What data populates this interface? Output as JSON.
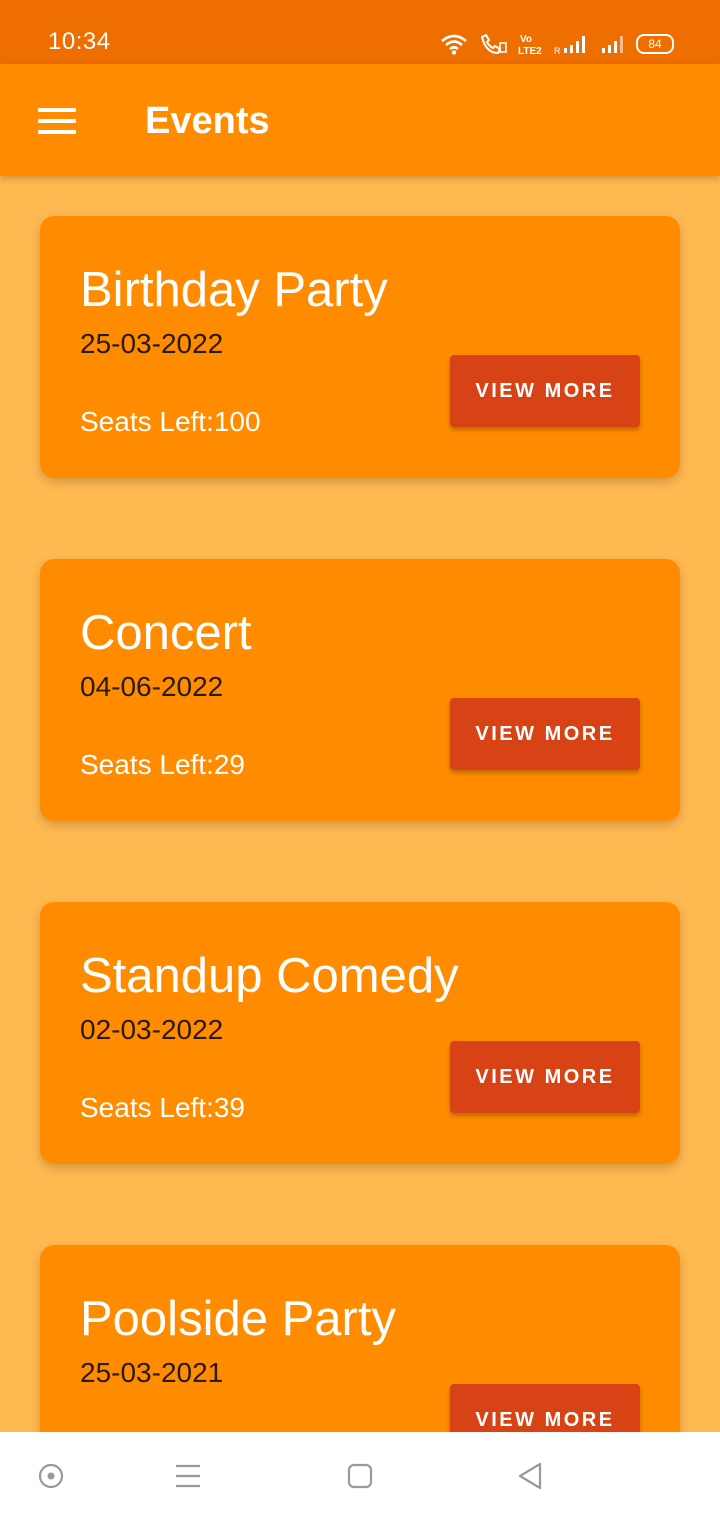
{
  "status": {
    "time": "10:34",
    "battery": "84",
    "icons": [
      "wifi-icon",
      "wifi-calling-icon",
      "volte-icon",
      "signal-icon",
      "signal-icon",
      "battery-icon"
    ],
    "volte_label": "Vo LTE"
  },
  "app_bar": {
    "title": "Events",
    "menu_icon": "menu-icon"
  },
  "events": [
    {
      "title": "Birthday Party",
      "date": "25-03-2022",
      "seats": "Seats Left:100",
      "button": "VIEW MORE"
    },
    {
      "title": "Concert",
      "date": "04-06-2022",
      "seats": "Seats Left:29",
      "button": "VIEW MORE"
    },
    {
      "title": "Standup Comedy",
      "date": "02-03-2022",
      "seats": "Seats Left:39",
      "button": "VIEW MORE"
    },
    {
      "title": "Poolside Party",
      "date": "25-03-2021",
      "seats": "",
      "button": "VIEW MORE"
    }
  ],
  "nav_bar": {
    "icons": [
      "assistant-icon",
      "recents-icon",
      "home-icon",
      "back-icon"
    ]
  },
  "colors": {
    "status_bar": "#EE6E00",
    "app_bar": "#FF8C00",
    "background": "#FFB951",
    "card": "#FF8C00",
    "button": "#D84315"
  }
}
